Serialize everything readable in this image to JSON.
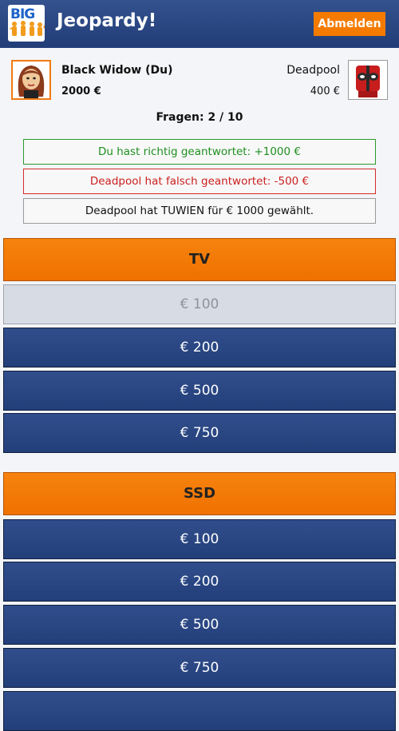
{
  "header": {
    "logo_text": "BIG",
    "title": "Jeopardy!",
    "logout_label": "Abmelden"
  },
  "player": {
    "name": "Black Widow (Du)",
    "score": "2000 €"
  },
  "opponent": {
    "name": "Deadpool",
    "score": "400 €"
  },
  "question_count": "Fragen: 2 / 10",
  "messages": {
    "correct": "Du hast richtig geantwortet: +1000 €",
    "wrong": "Deadpool hat falsch geantwortet: -500 €",
    "info": "Deadpool hat TUWIEN für € 1000 gewählt."
  },
  "categories": [
    {
      "name": "TV",
      "questions": [
        {
          "label": "€ 100",
          "answered": true
        },
        {
          "label": "€ 200",
          "answered": false
        },
        {
          "label": "€ 500",
          "answered": false
        },
        {
          "label": "€ 750",
          "answered": false
        }
      ]
    },
    {
      "name": "SSD",
      "questions": [
        {
          "label": "€ 100",
          "answered": false
        },
        {
          "label": "€ 200",
          "answered": false
        },
        {
          "label": "€ 500",
          "answered": false
        },
        {
          "label": "€ 750",
          "answered": false
        }
      ]
    }
  ],
  "colors": {
    "header": "#2b4a87",
    "accent": "#f47b00",
    "question": "#2a4784",
    "answered": "#d7dbe4",
    "success": "#1f8f1f",
    "error": "#cc1f1f"
  }
}
